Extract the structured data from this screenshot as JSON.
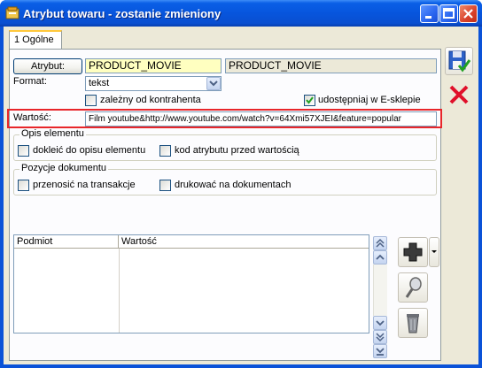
{
  "window": {
    "title": "Atrybut towaru - zostanie zmieniony"
  },
  "tabs": [
    {
      "label": "1 Ogólne"
    }
  ],
  "form": {
    "atrybut_button": "Atrybut:",
    "atrybut_code": "PRODUCT_MOVIE",
    "atrybut_name": "PRODUCT_MOVIE",
    "format_label": "Format:",
    "format_value": "tekst",
    "zalezny_label": "zależny od kontrahenta",
    "zalezny_checked": false,
    "udostepniaj_label": "udostępniaj w E-sklepie",
    "udostepniaj_checked": true,
    "wartosc_label": "Wartość:",
    "wartosc_value": "Film youtube&http://www.youtube.com/watch?v=64Xmi57XJEI&feature=popular"
  },
  "opis": {
    "legend": "Opis elementu",
    "doklejc_label": "dokleić do opisu elementu",
    "doklejc_checked": false,
    "kod_label": "kod atrybutu przed wartością",
    "kod_checked": false
  },
  "pozycje": {
    "legend": "Pozycje dokumentu",
    "przenosic_label": "przenosić na transakcje",
    "przenosic_checked": false,
    "drukowac_label": "drukować na dokumentach",
    "drukowac_checked": false
  },
  "grid": {
    "columns": [
      "Podmiot",
      "Wartość"
    ],
    "rows": []
  },
  "colors": {
    "highlight_border": "#e8262a",
    "field_highlight": "#ffffc0",
    "title_bar": "#0755dd",
    "delete_x": "#e0102a"
  },
  "side_icons": [
    "save-icon",
    "cancel-icon"
  ],
  "grid_icons": [
    "add-icon",
    "edit-icon",
    "delete-icon"
  ]
}
